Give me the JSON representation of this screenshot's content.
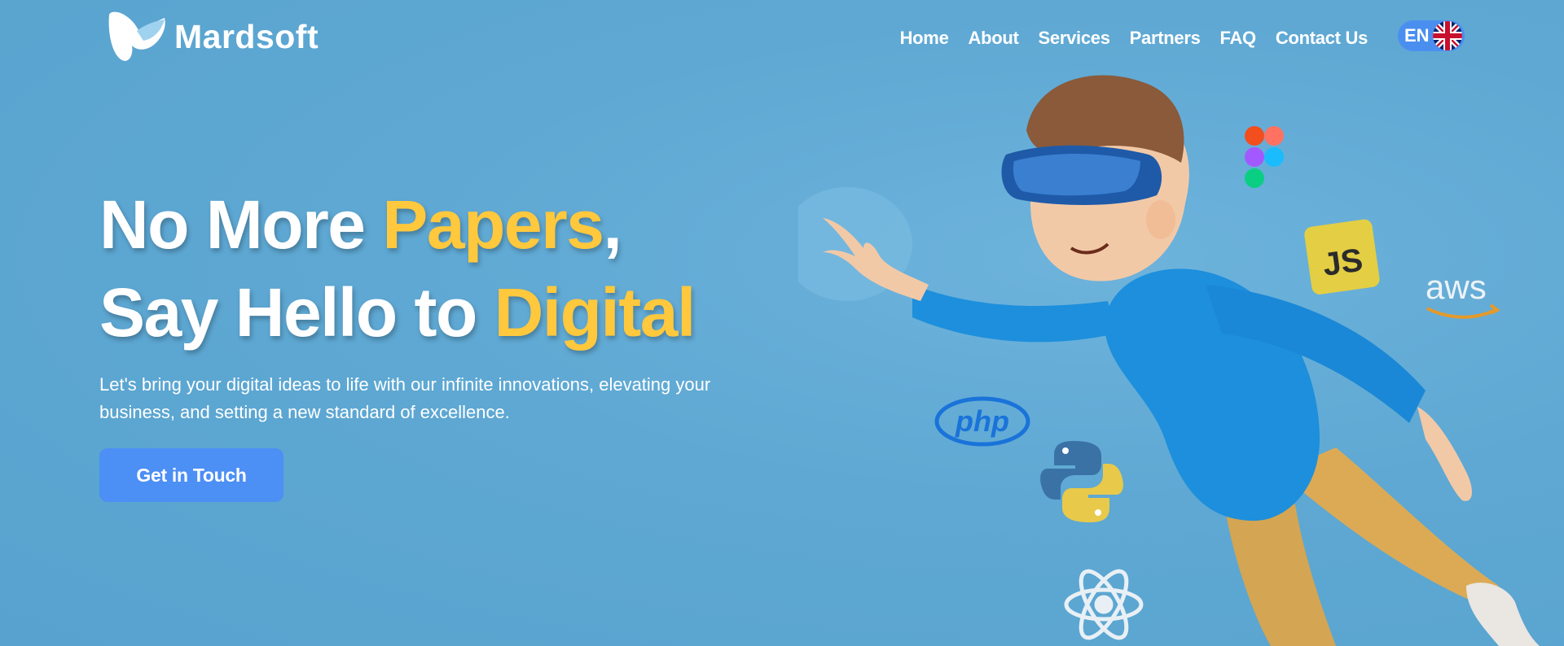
{
  "brand": {
    "name": "Mardsoft"
  },
  "nav": {
    "items": [
      "Home",
      "About",
      "Services",
      "Partners",
      "FAQ",
      "Contact Us"
    ]
  },
  "language": {
    "code": "EN",
    "flag": "uk-flag-icon"
  },
  "hero": {
    "line1_part1": "No More ",
    "line1_highlight": "Papers",
    "line1_end": ",",
    "line2_part1": "Say Hello to ",
    "line2_highlight": "Digital",
    "subtitle": "Let's bring your digital ideas to life with our infinite innovations, elevating your business, and setting a new standard of excellence.",
    "cta_label": "Get in Touch"
  },
  "illustration": {
    "icons": [
      "figma-icon",
      "javascript-icon",
      "aws-icon",
      "php-icon",
      "python-icon",
      "react-icon"
    ],
    "php_text": "php",
    "js_text": "JS",
    "aws_text": "aws"
  },
  "colors": {
    "background": "#5fa9d4",
    "highlight": "#ffc83d",
    "button": "#4c8ff5",
    "language_pill": "#4a8ff0"
  }
}
